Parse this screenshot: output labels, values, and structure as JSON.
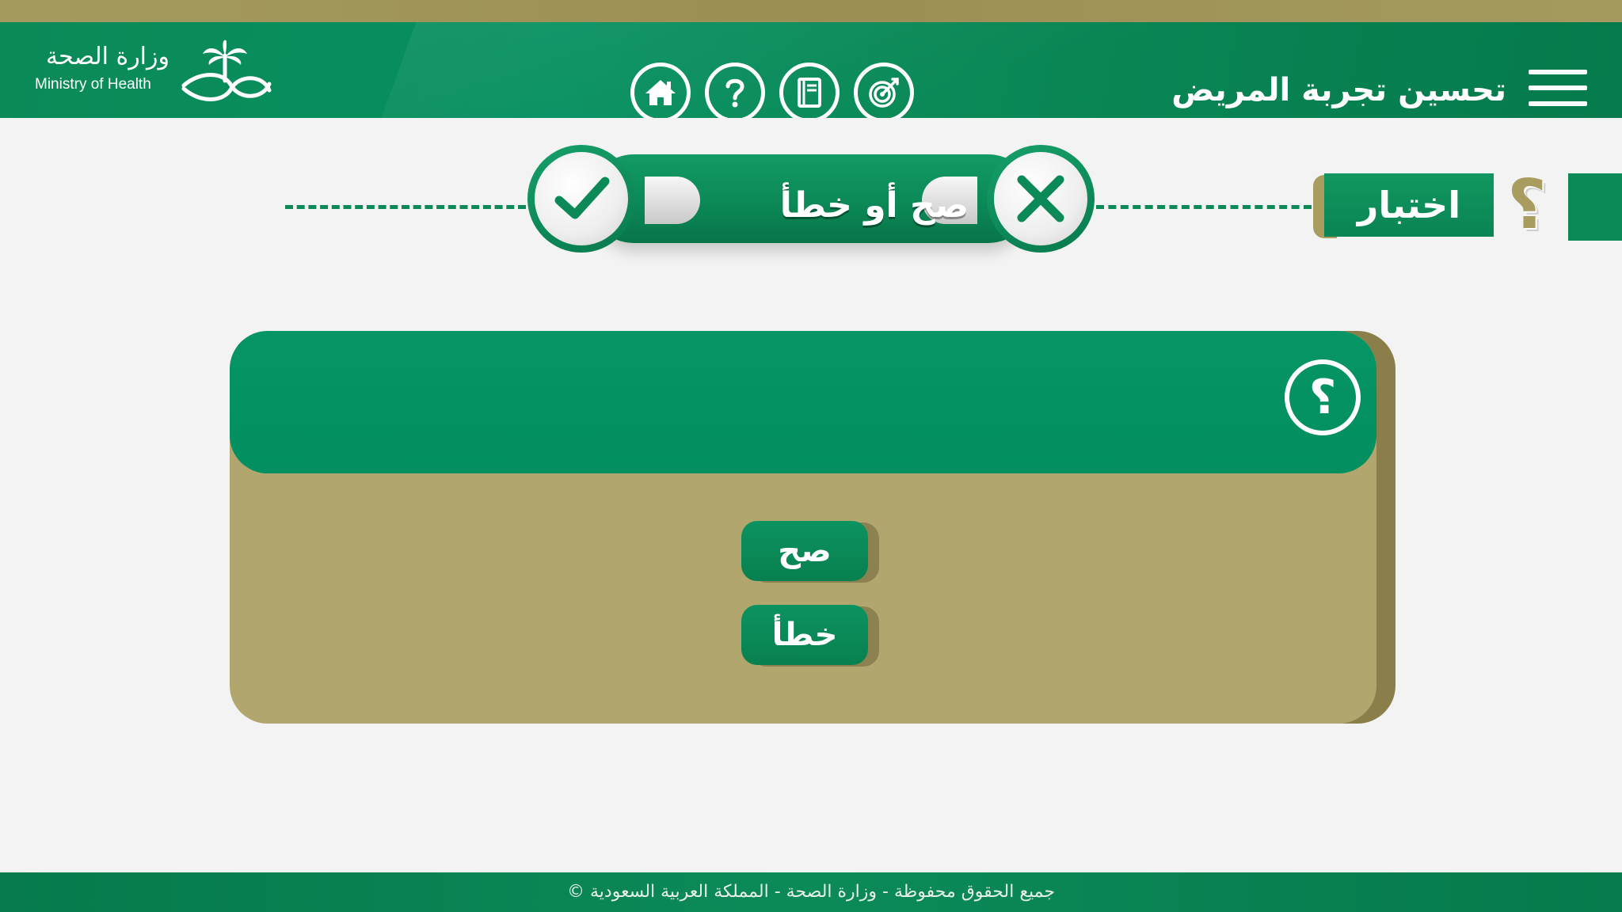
{
  "header": {
    "logo_ar": "وزارة الصحة",
    "logo_en": "Ministry of Health",
    "app_title": "تحسين تجربة المريض",
    "nav": [
      {
        "name": "home",
        "icon": "home-icon"
      },
      {
        "name": "help",
        "icon": "question-icon"
      },
      {
        "name": "guide",
        "icon": "book-icon"
      },
      {
        "name": "goals",
        "icon": "target-icon"
      }
    ],
    "menu_icon": "hamburger-menu-icon"
  },
  "quiz": {
    "section_label": "اختبار",
    "type_title": "صح أو خطأ",
    "question_mark": "؟"
  },
  "question": {
    "text": "",
    "icon": "؟"
  },
  "answers": {
    "true_label": "صح",
    "false_label": "خطأ"
  },
  "footer": {
    "text": "جميع الحقوق محفوظة - وزارة الصحة - المملكة العربية السعودية ©"
  },
  "colors": {
    "brand_green": "#0b8a58",
    "gold": "#b2a66f",
    "gold_dark": "#a89c5e",
    "background": "#f2f3f2"
  }
}
